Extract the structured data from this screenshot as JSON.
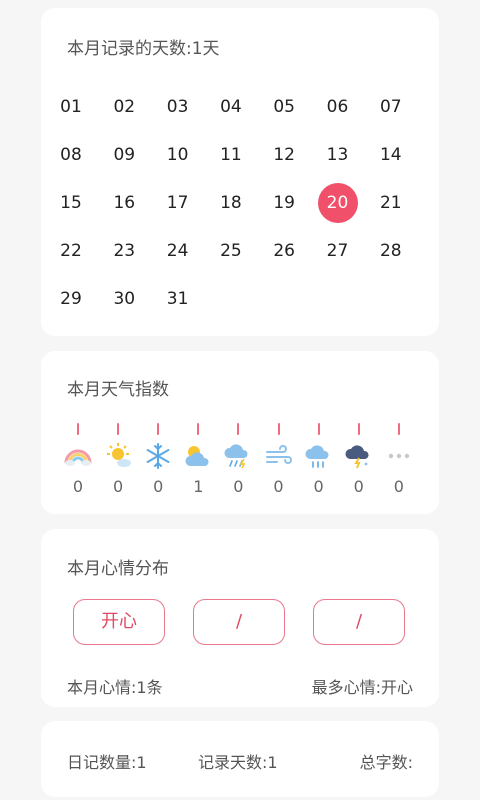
{
  "calendar": {
    "title": "本月记录的天数:1天",
    "days": [
      "01",
      "02",
      "03",
      "04",
      "05",
      "06",
      "07",
      "08",
      "09",
      "10",
      "11",
      "12",
      "13",
      "14",
      "15",
      "16",
      "17",
      "18",
      "19",
      "20",
      "21",
      "22",
      "23",
      "24",
      "25",
      "26",
      "27",
      "28",
      "29",
      "30",
      "31"
    ],
    "selected_day": "20",
    "highlight_color": "#f0506a"
  },
  "weather": {
    "title": "本月天气指数",
    "items": [
      {
        "icon": "rainbow-icon",
        "count": "0"
      },
      {
        "icon": "sun-icon",
        "count": "0"
      },
      {
        "icon": "snowflake-icon",
        "count": "0"
      },
      {
        "icon": "partly-cloudy-icon",
        "count": "1"
      },
      {
        "icon": "thunder-rain-icon",
        "count": "0"
      },
      {
        "icon": "wind-icon",
        "count": "0"
      },
      {
        "icon": "rain-cloud-icon",
        "count": "0"
      },
      {
        "icon": "thunderstorm-icon",
        "count": "0"
      },
      {
        "icon": "more-icon",
        "count": "0"
      }
    ]
  },
  "mood": {
    "title": "本月心情分布",
    "buttons": [
      "开心",
      "/",
      "/"
    ],
    "count_label": "本月心情:1条",
    "top_mood_label": "最多心情:开心",
    "accent_color": "#e04a64"
  },
  "stats": {
    "diary_count": "日记数量:1",
    "record_days": "记录天数:1",
    "total_words": "总字数:"
  }
}
